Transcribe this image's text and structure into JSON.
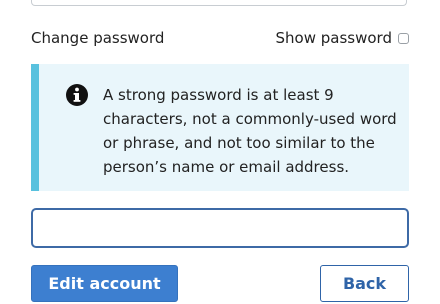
{
  "form": {
    "change_password_label": "Change password",
    "show_password_label": "Show password",
    "show_password_checked": false,
    "notice_text": "A strong password is at least 9 characters, not a commonly-used word or phrase, and not too similar to the person’s name or email address.",
    "password_value": "",
    "password_placeholder": ""
  },
  "actions": {
    "edit_account_label": "Edit account",
    "back_label": "Back"
  },
  "icons": {
    "notice_icon": "info-icon"
  },
  "colors": {
    "notice_bg": "#e9f6fb",
    "notice_border": "#58c1de",
    "primary": "#3d7fd0",
    "secondary_text": "#2f64a8",
    "input_focus_border": "#3e6aa6"
  }
}
